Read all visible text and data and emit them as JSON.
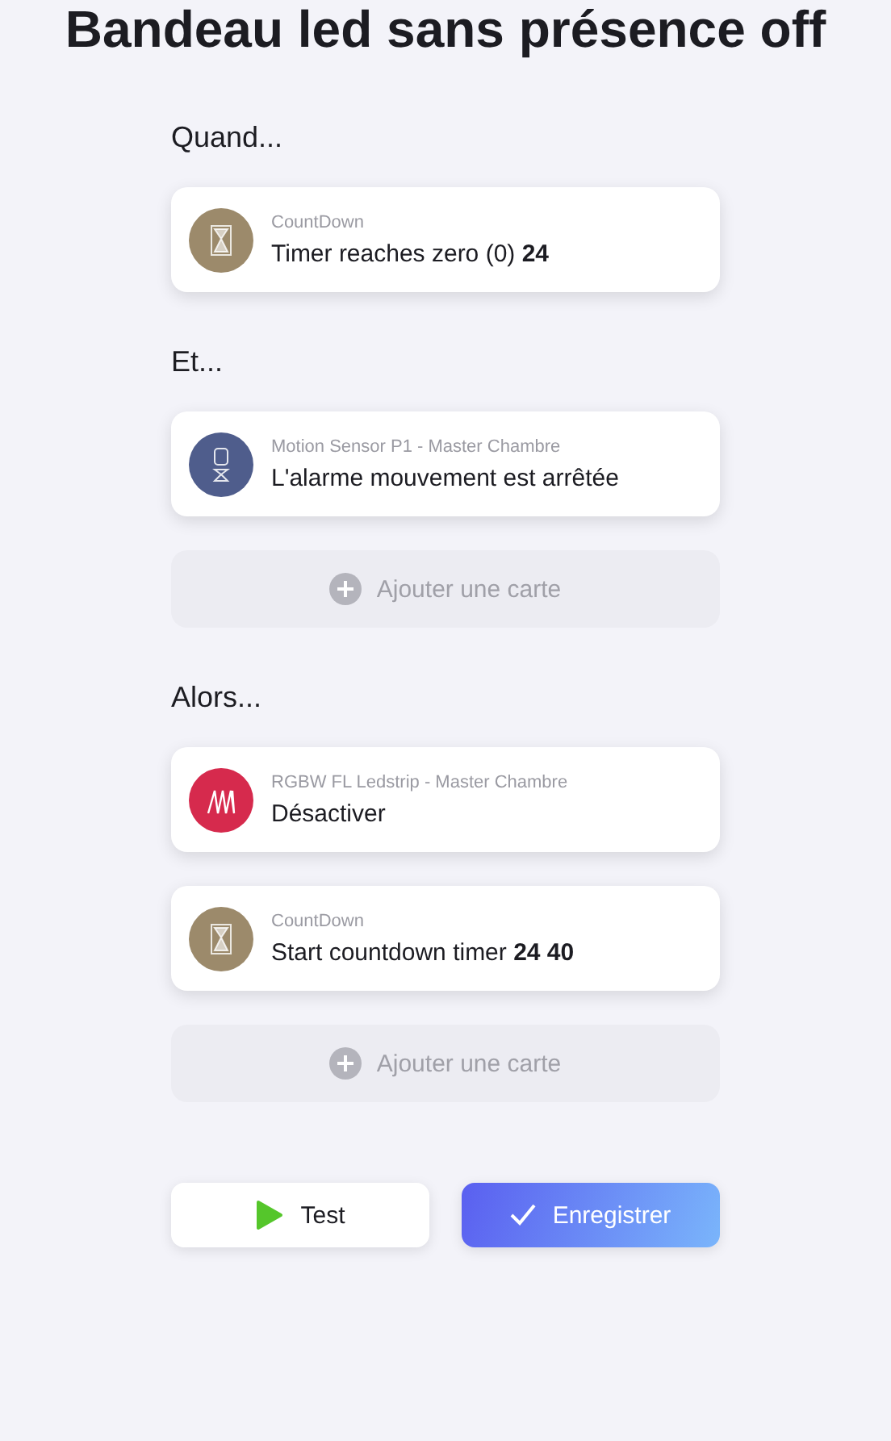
{
  "title": "Bandeau led sans présence off",
  "sections": [
    {
      "heading": "Quand...",
      "cards": [
        {
          "kind": "hourglass",
          "color": "#9c8a6b",
          "device": "CountDown",
          "text": "Timer reaches zero (0) **24**"
        }
      ]
    },
    {
      "heading": "Et...",
      "cards": [
        {
          "kind": "sensor",
          "color": "#4f5d8c",
          "device": "Motion Sensor P1 - Master Chambre",
          "text": "L'alarme mouvement est arrêtée"
        }
      ],
      "add_label": "Ajouter une carte"
    },
    {
      "heading": "Alors...",
      "cards": [
        {
          "kind": "ledstrip",
          "color": "#d62a4d",
          "device": "RGBW FL Ledstrip - Master Chambre",
          "text": "Désactiver"
        },
        {
          "kind": "hourglass",
          "color": "#9c8a6b",
          "device": "CountDown",
          "text": "Start countdown timer **24 40**"
        }
      ],
      "add_label": "Ajouter une carte"
    }
  ],
  "buttons": [
    {
      "kind": "test",
      "label": "Test"
    },
    {
      "kind": "save",
      "label": "Enregistrer"
    }
  ]
}
